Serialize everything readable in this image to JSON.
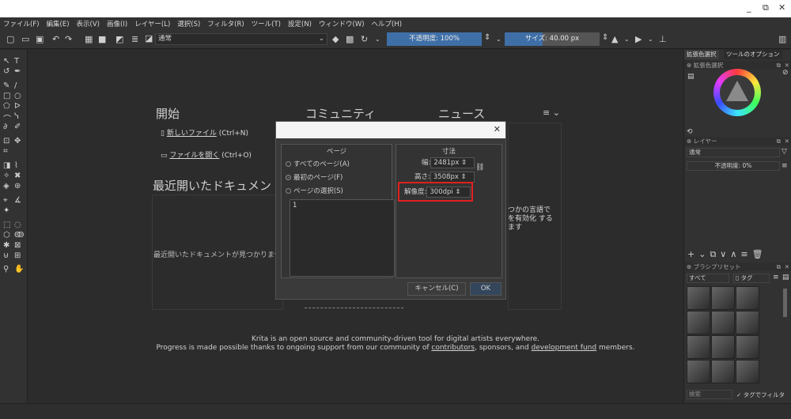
{
  "window": {
    "controls": [
      "_",
      "⧉",
      "✕"
    ]
  },
  "menubar": [
    "ファイル(F)",
    "編集(E)",
    "表示(V)",
    "画像(I)",
    "レイヤー(L)",
    "選択(S)",
    "フィルタ(R)",
    "ツール(T)",
    "設定(N)",
    "ウィンドウ(W)",
    "ヘルプ(H)"
  ],
  "toolbar": {
    "blend_mode": "通常",
    "opacity_label": "不透明度: 100%",
    "size_label": "サイズ: 40.00 px"
  },
  "welcome": {
    "start_heading": "開始",
    "community_heading": "コミュニティ",
    "news_heading": "ニュース",
    "new_file_label": "新しいファイル",
    "new_file_shortcut": "(Ctrl+N)",
    "open_file_label": "ファイルを開く",
    "open_file_shortcut": "(Ctrl+O)",
    "recent_heading": "最近開いたドキュメン",
    "recent_empty": "最近開いたドキュメントが見つかりませ",
    "news_partial_1": "つかの言語で",
    "news_partial_2": "を有効化 する",
    "news_partial_3": "ます",
    "footer_line1": "Krita is an open source and community-driven tool for digital artists everywhere.",
    "footer_line2_pre": "Progress is made possible thanks to ongoing support from our community of ",
    "footer_contributors": "contributors",
    "footer_mid": ", sponsors, and ",
    "footer_devfund": "development fund",
    "footer_end": " members."
  },
  "dialog": {
    "close": "✕",
    "pages_group": "ページ",
    "radio_all": "すべてのページ(A)",
    "radio_first": "最初のページ(F)",
    "radio_select": "ページの選択(S)",
    "page_list_value": "1",
    "dims_group": "寸法",
    "width_label": "幅:",
    "width_value": "2481px",
    "height_label": "高さ:",
    "height_value": "3508px",
    "resolution_label": "解像度:",
    "resolution_value": "300dpi",
    "cancel_button": "キャンセル(C)",
    "ok_button": "OK"
  },
  "right_panel": {
    "tab1": "拡張色選択",
    "tab2": "ツールのオプション",
    "color_header": "拡張色選択",
    "layers_header": "レイヤー",
    "layers_blend": "通常",
    "layers_opacity": "不透明度: 0%",
    "presets_header": "ブラシプリセット",
    "presets_filter": "すべて",
    "presets_tag": "タグ",
    "search_placeholder": "検索",
    "tag_filter": "✓ タグでフィルタ"
  },
  "colors": {
    "accent": "#3f6fa7",
    "highlight": "#e02020"
  }
}
